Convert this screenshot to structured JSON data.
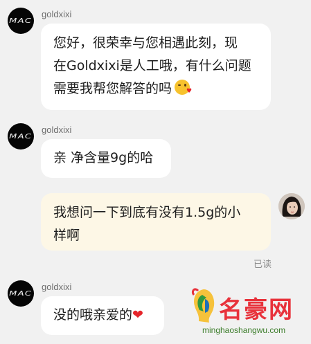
{
  "messages": [
    {
      "sender": "goldxixi",
      "avatar_logo": "MAC",
      "lines": [
        "您好，很荣幸与您相遇此刻，现",
        "在Goldxixi是人工哦，有什么问题",
        "需要我帮您解答的吗"
      ],
      "emoji": "kissing-wink-face"
    },
    {
      "sender": "goldxixi",
      "avatar_logo": "MAC",
      "lines": [
        "亲 净含量9g的哈"
      ]
    },
    {
      "sender": "self",
      "lines": [
        "我想问一下到底有没有1.5g的小",
        "样啊"
      ],
      "status": "已读"
    },
    {
      "sender": "goldxixi",
      "avatar_logo": "MAC",
      "lines": [
        "没的哦亲爱的"
      ],
      "emoji": "heart"
    }
  ],
  "watermark": {
    "brand": "名豪网",
    "url": "minghaoshangwu.com"
  },
  "colors": {
    "background": "#f1f1f1",
    "incoming_bubble": "#ffffff",
    "outgoing_bubble": "#fdf7e6",
    "heart": "#e5252b",
    "watermark_red": "#e8323b"
  }
}
